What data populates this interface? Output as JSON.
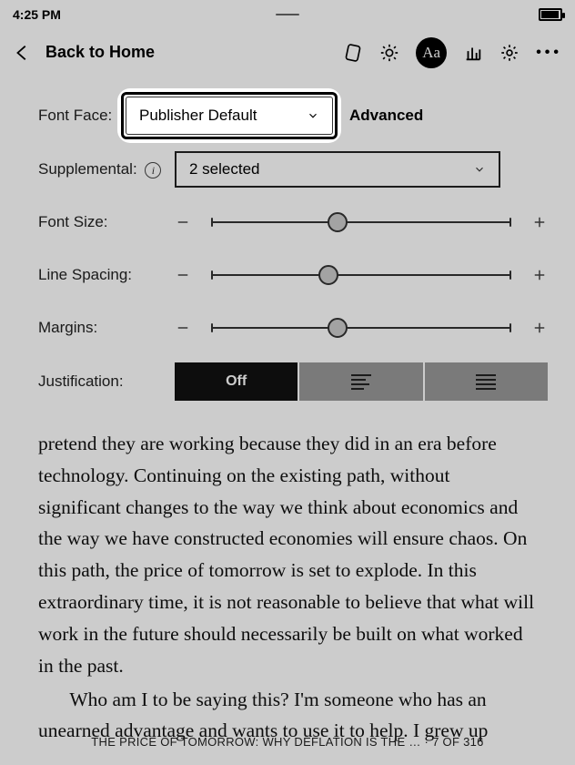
{
  "status": {
    "time": "4:25 PM"
  },
  "header": {
    "back_label": "Back to Home"
  },
  "panel": {
    "font_face_label": "Font Face:",
    "font_face_value": "Publisher Default",
    "advanced_label": "Advanced",
    "supplemental_label": "Supplemental:",
    "supplemental_value": "2 selected",
    "font_size_label": "Font Size:",
    "line_spacing_label": "Line Spacing:",
    "margins_label": "Margins:",
    "justification_label": "Justification:",
    "justification_off": "Off",
    "sliders": {
      "font_size_pct": 42,
      "line_spacing_pct": 39,
      "margins_pct": 42
    }
  },
  "book": {
    "para1": "pretend they are working because they did in an era before technology. Continuing on the existing path, without significant changes to the way we think about economics and the way we have constructed economies will ensure chaos. On this path, the price of tomorrow is set to explode. In this extraordinary time, it is not reasonable to believe that what will work in the future should necessarily be built on what worked in the past.",
    "para2": "Who am I to be saying this? I'm someone who has an unearned advantage and wants to use it to help. I grew up",
    "footer": "THE PRICE OF TOMORROW: WHY DEFLATION IS THE … · 7 OF 316"
  }
}
